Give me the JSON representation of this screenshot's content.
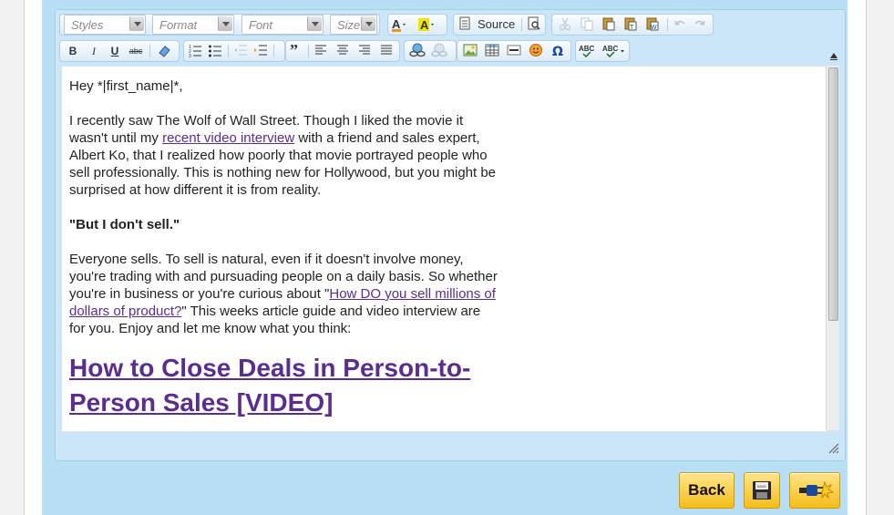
{
  "toolbar": {
    "combos": {
      "styles": "Styles",
      "format": "Format",
      "font": "Font",
      "size": "Size"
    },
    "source_label": "Source",
    "bold_glyph": "B",
    "italic_glyph": "I",
    "underline_glyph": "U",
    "strike_glyph": "abc",
    "spell1_glyph": "ABC",
    "spell2_glyph": "ABC"
  },
  "content": {
    "greeting": "Hey *|first_name|*,",
    "para1_before": "I recently saw The Wolf of Wall Street. Though I liked the movie it wasn't until my ",
    "para1_link": "recent video interview",
    "para1_after": " with a friend and sales expert, Albert Ko, that I realized how poorly that movie portrayed people who sell professionally. This is nothing new for Hollywood, but you might be surprised at how different it is from reality.",
    "quote": "\"But I don't sell.\"",
    "para2_before": "Everyone sells. To sell is natural, even if it doesn't involve money, you're trading with and pursuading people on a daily basis. So whether you're in business or you're curious about \"",
    "para2_link": "How DO you sell millions of dollars of product?",
    "para2_after": "\" This weeks article guide and video interview are for you. Enjoy and let me know what you think:",
    "heading": "How to Close Deals in Person-to-Person Sales [VIDEO]"
  },
  "buttons": {
    "back_label": "Back",
    "save_icon_text": "SAVE"
  },
  "colors": {
    "panel": "#b9dff7",
    "link": "#5c2d91",
    "button_gold": "#f6bd1c"
  }
}
